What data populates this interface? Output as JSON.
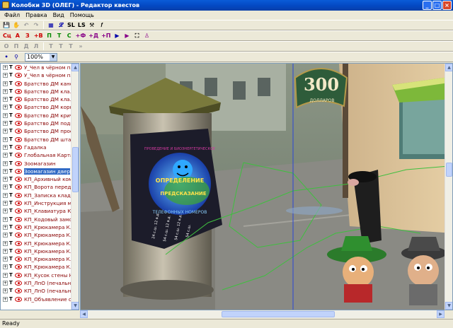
{
  "window": {
    "title": "Колобки 3D (ОЛЕГ) - Редактор квестов",
    "controls": [
      "_",
      "□",
      "×"
    ]
  },
  "menu": [
    "Файл",
    "Правка",
    "Вид",
    "Помощь"
  ],
  "toolbar1": {
    "items": [
      "💾",
      "✋",
      "↶",
      "↷",
      "▦",
      "𝓛",
      "SL",
      "LS",
      "⚒",
      "𝑓"
    ]
  },
  "toolbar2": {
    "items": [
      "Сц",
      "А",
      "З",
      "+В",
      "П",
      "Т",
      "С",
      "+Ф",
      "+Д",
      "+П",
      "▶",
      "▶",
      "⛶",
      "♙"
    ]
  },
  "toolbar3": {
    "items": [
      "О",
      "П",
      "Д",
      "Л",
      "Т",
      "Т",
      "Т",
      "»"
    ]
  },
  "toolbar4": {
    "zoom": "100%"
  },
  "tree": {
    "items": [
      "У_Чел в чёрном пл...",
      "У_Чел в чёрном пл...",
      "Братство ДМ кано...",
      "Братство ДМ кла...",
      "Братство ДМ кла...",
      "Братство ДМ корн...",
      "Братство ДМ крич...",
      "Братство ДМ подн...",
      "Братство ДМ прос...",
      "Братство ДМ штаб",
      "Гадалка",
      "Глобальная Карта",
      "Зоомагазин",
      "Зоомагазин двер",
      "КП_Архивный ком...",
      "КП_Ворота перед ...",
      "КП_Записка клад...",
      "КП_Инструкция м...",
      "КП_Клавиатура Кр...",
      "КП_Кодовый замо...",
      "КП_Крюкамера К...",
      "КП_Крюкамера К...",
      "КП_Крюкамера К...",
      "КП_Крюкамера К...",
      "КП_Крюкамера К...",
      "КП_Крюкамера К...",
      "КП_Кусок стены Н...",
      "КП_ЛпО (печальная...",
      "КП_ЛпО (печальная...",
      "КП_Объявление о ..."
    ],
    "selected_index": 13
  },
  "scene": {
    "sign_number": "300",
    "sign_sub": "ДОЛЛАРОВ",
    "poster_lines": [
      "ПРОВЕДЕНИЕ И БИОЭНЕРГЕТИЧЕСКОЕ",
      "ОПРЕДЕЛЕНИЕ",
      "ПРЕДСКАЗАНИЕ",
      "ТЕЛЕФОННЫХ НОМЕРОВ"
    ],
    "tab_texts": [
      "24 с.ш. 12 в.д.",
      "54 с.ш. 12 в.д.",
      "54 с.ш. 12 в.д.",
      "54 с.ш."
    ]
  },
  "status": {
    "text": "Ready"
  }
}
